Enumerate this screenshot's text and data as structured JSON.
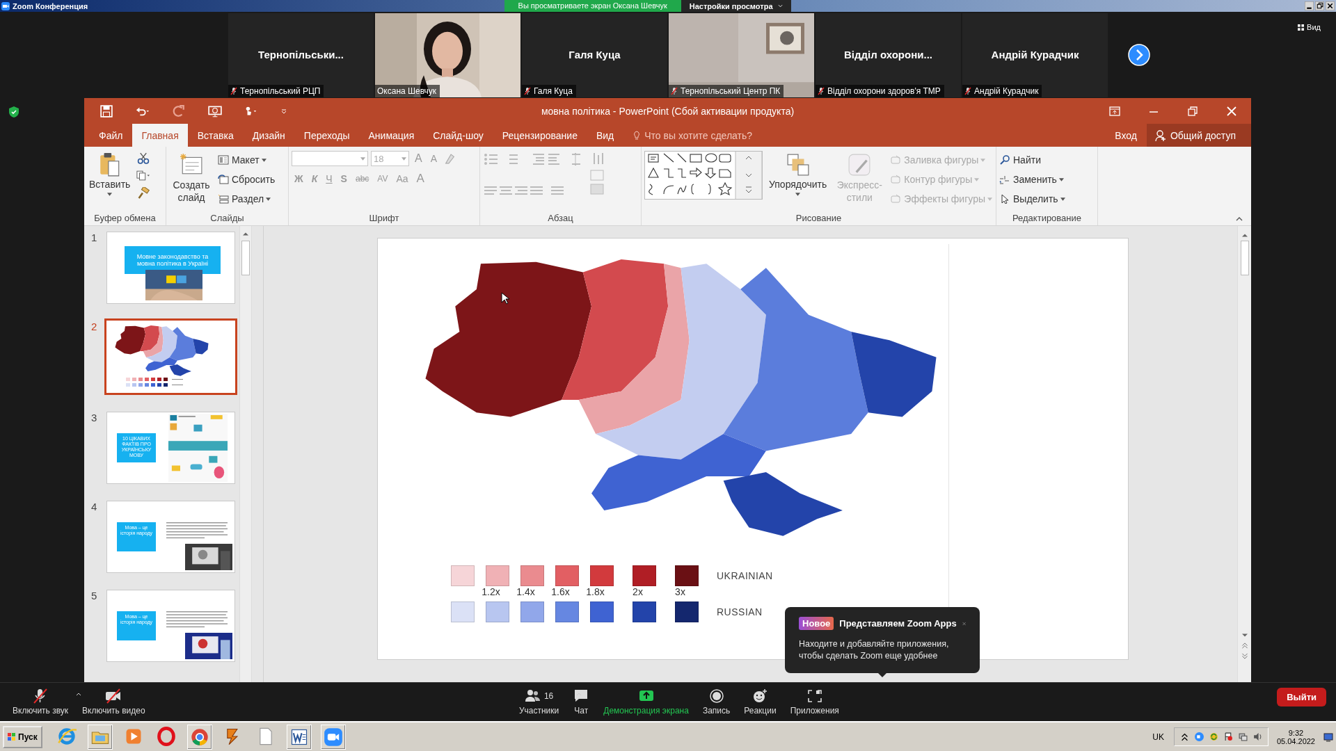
{
  "zoom_bar": {
    "title": "Zoom Конференция",
    "share_notice": "Вы просматриваете экран Оксана Шевчук",
    "view_settings": "Настройки просмотра"
  },
  "view_button": "Вид",
  "participants": [
    {
      "kind": "name",
      "display_name": "Тернопільськи...",
      "label": "Тернопільський РЦП",
      "muted": true
    },
    {
      "kind": "video",
      "label": "Оксана Шевчук",
      "muted": false
    },
    {
      "kind": "name",
      "display_name": "Галя Куца",
      "label": "Галя Куца",
      "muted": true
    },
    {
      "kind": "video",
      "label": "Тернопільський Центр ПК",
      "muted": true
    },
    {
      "kind": "name",
      "display_name": "Відділ  охорони...",
      "label": "Відділ охорони здоров'я ТМР",
      "muted": true
    },
    {
      "kind": "name",
      "display_name": "Андрій Курадчик",
      "label": "Андрій Курадчик",
      "muted": true
    }
  ],
  "ppt": {
    "title": "мовна політика - PowerPoint (Сбой активации продукта)",
    "tabs": [
      {
        "label": "Файл",
        "selected": false
      },
      {
        "label": "Главная",
        "selected": true
      },
      {
        "label": "Вставка",
        "selected": false
      },
      {
        "label": "Дизайн",
        "selected": false
      },
      {
        "label": "Переходы",
        "selected": false
      },
      {
        "label": "Анимация",
        "selected": false
      },
      {
        "label": "Слайд-шоу",
        "selected": false
      },
      {
        "label": "Рецензирование",
        "selected": false
      },
      {
        "label": "Вид",
        "selected": false
      }
    ],
    "tell_me": "Что вы хотите сделать?",
    "sign_in": "Вход",
    "share": "Общий доступ"
  },
  "ribbon": {
    "clipboard": {
      "paste": "Вставить",
      "label": "Буфер обмена"
    },
    "slides": {
      "new_slide": "Создать слайд",
      "layout": "Макет",
      "reset": "Сбросить",
      "section": "Раздел",
      "label": "Слайды"
    },
    "font": {
      "size": "18",
      "size_buttons": [
        "A",
        "A"
      ],
      "buttons": [
        "Ж",
        "К",
        "Ч",
        "S",
        "abc",
        "AV",
        "Aa",
        "A"
      ],
      "label": "Шрифт"
    },
    "paragraph": {
      "label": "Абзац"
    },
    "drawing": {
      "arrange": "Упорядочить",
      "quick_styles": {
        "label": "Экспресс-стили",
        "disabled": true
      },
      "commands": [
        {
          "label": "Заливка фигуры",
          "disabled": true
        },
        {
          "label": "Контур фигуры",
          "disabled": true
        },
        {
          "label": "Эффекты фигуры",
          "disabled": true
        }
      ],
      "label": "Рисование"
    },
    "editing": {
      "commands": [
        "Найти",
        "Заменить",
        "Выделить"
      ],
      "label": "Редактирование"
    }
  },
  "slides": [
    {
      "number": "1",
      "selected": false,
      "kind": "title",
      "caption": "Мовне законодавство та мовна політика в Україні"
    },
    {
      "number": "2",
      "selected": true,
      "kind": "map"
    },
    {
      "number": "3",
      "selected": false,
      "kind": "infographic",
      "caption": "10 ЦІКАВИХ ФАКТІВ ПРО УКРАЇНСЬКУ МОВУ"
    },
    {
      "number": "4",
      "selected": false,
      "kind": "text",
      "caption": "Мова – це історія народу"
    },
    {
      "number": "5",
      "selected": false,
      "kind": "text",
      "caption": "Мова – це історія народу"
    }
  ],
  "slide": {
    "legend": {
      "rows": [
        {
          "label": "UKRAINIAN",
          "swatches": [
            {
              "color": "#f6d5d8"
            },
            {
              "color": "#f0b1b5"
            },
            {
              "color": "#ea8b8f"
            },
            {
              "color": "#e25f63"
            },
            {
              "color": "#d23a3d"
            },
            {
              "color": "#b01e25"
            },
            {
              "color": "#6a1014"
            }
          ]
        },
        {
          "label": "RUSSIAN",
          "swatches": [
            {
              "color": "#dbe1f6"
            },
            {
              "color": "#b8c6f0"
            },
            {
              "color": "#91a7ea"
            },
            {
              "color": "#6687e1"
            },
            {
              "color": "#3f63d2"
            },
            {
              "color": "#2344aa"
            },
            {
              "color": "#14276e"
            }
          ]
        }
      ],
      "ticks": [
        "1.2x",
        "1.4x",
        "1.6x",
        "1.8x",
        "2x",
        "3x"
      ]
    }
  },
  "popup": {
    "badge": "Новое",
    "title": "Представляем Zoom Apps",
    "text": "Находите и добавляйте приложения, чтобы сделать Zoom еще удобнее"
  },
  "toolbar": [
    {
      "kind": "audio",
      "label": "Включить звук"
    },
    {
      "kind": "video",
      "label": "Включить видео"
    },
    {
      "kind": "participants",
      "label": "Участники",
      "count": "16"
    },
    {
      "kind": "chat",
      "label": "Чат"
    },
    {
      "kind": "share",
      "label": "Демонстрация экрана"
    },
    {
      "kind": "record",
      "label": "Запись"
    },
    {
      "kind": "reactions",
      "label": "Реакции"
    },
    {
      "kind": "apps",
      "label": "Приложения"
    }
  ],
  "leave": "Выйти",
  "taskbar": {
    "start": "Пуск",
    "language": "UK",
    "time": "9:32",
    "date": "05.04.2022"
  }
}
